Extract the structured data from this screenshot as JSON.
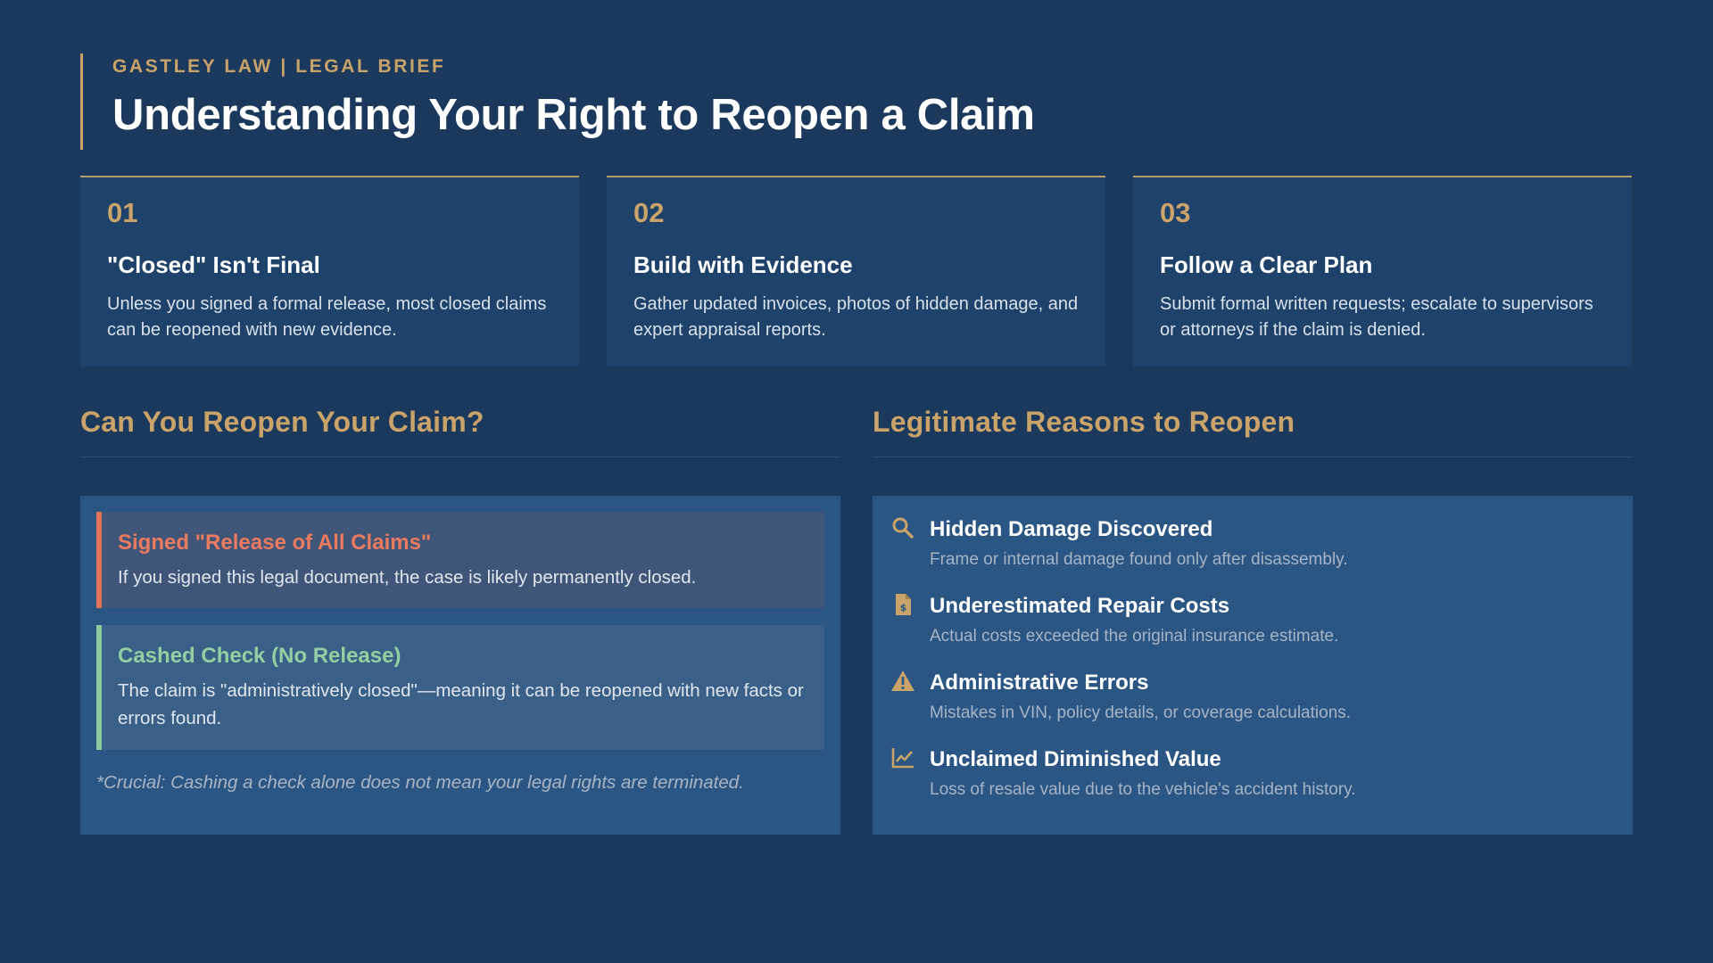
{
  "header": {
    "brand": "GASTLEY LAW | LEGAL BRIEF",
    "title": "Understanding Your Right to Reopen a Claim"
  },
  "cards": [
    {
      "number": "01",
      "title": "\"Closed\" Isn't Final",
      "text": "Unless you signed a formal release, most closed claims can be reopened with new evidence."
    },
    {
      "number": "02",
      "title": "Build with Evidence",
      "text": "Gather updated invoices, photos of hidden damage, and expert appraisal reports."
    },
    {
      "number": "03",
      "title": "Follow a Clear Plan",
      "text": "Submit formal written requests; escalate to supervisors or attorneys if the claim is denied."
    }
  ],
  "left_section": {
    "heading": "Can You Reopen Your Claim?",
    "callouts": [
      {
        "title": "Signed \"Release of All Claims\"",
        "text": "If you signed this legal document, the case is likely permanently closed."
      },
      {
        "title": "Cashed Check (No Release)",
        "text": "The claim is \"administratively closed\"—meaning it can be reopened with new facts or errors found."
      }
    ],
    "note": "*Crucial: Cashing a check alone does not mean your legal rights are terminated."
  },
  "right_section": {
    "heading": "Legitimate Reasons to Reopen",
    "reasons": [
      {
        "icon": "magnifier-icon",
        "title": "Hidden Damage Discovered",
        "text": "Frame or internal damage found only after disassembly."
      },
      {
        "icon": "invoice-icon",
        "title": "Underestimated Repair Costs",
        "text": "Actual costs exceeded the original insurance estimate."
      },
      {
        "icon": "warning-icon",
        "title": "Administrative Errors",
        "text": "Mistakes in VIN, policy details, or coverage calculations."
      },
      {
        "icon": "line-chart-icon",
        "title": "Unclaimed Diminished Value",
        "text": "Loss of resale value due to the vehicle's accident history."
      }
    ]
  },
  "colors": {
    "background": "#1a395c",
    "accent_gold": "#c9a36a",
    "warning_red": "#e0735a",
    "success_green": "#8fc9a0"
  }
}
